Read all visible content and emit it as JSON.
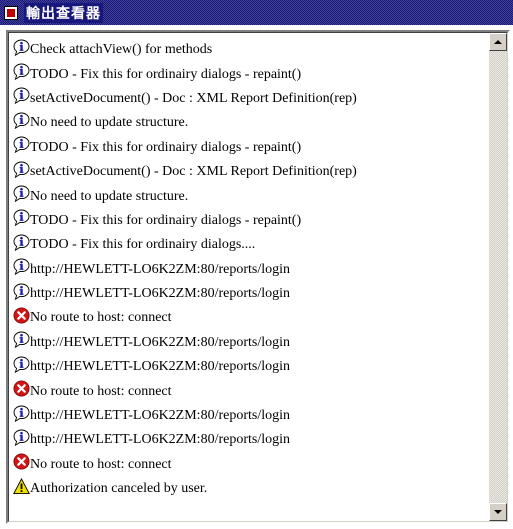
{
  "window": {
    "title": "輸出查看器"
  },
  "colors": {
    "titlebar": "#18177c",
    "info_icon": "#1a1aa6",
    "error_icon": "#d21414",
    "warning_icon": "#f0e000"
  },
  "log": {
    "entries": [
      {
        "icon": "info-icon",
        "text": "Check attachView() for methods"
      },
      {
        "icon": "info-icon",
        "text": "TODO - Fix this for ordinairy dialogs - repaint()"
      },
      {
        "icon": "info-icon",
        "text": "setActiveDocument() - Doc : XML Report Definition(rep)"
      },
      {
        "icon": "info-icon",
        "text": "No need to update structure."
      },
      {
        "icon": "info-icon",
        "text": "TODO - Fix this for ordinairy dialogs - repaint()"
      },
      {
        "icon": "info-icon",
        "text": "setActiveDocument() - Doc : XML Report Definition(rep)"
      },
      {
        "icon": "info-icon",
        "text": "No need to update structure."
      },
      {
        "icon": "info-icon",
        "text": "TODO - Fix this for ordinairy dialogs - repaint()"
      },
      {
        "icon": "info-icon",
        "text": "TODO - Fix this for ordinairy dialogs...."
      },
      {
        "icon": "info-icon",
        "text": "http://HEWLETT-LO6K2ZM:80/reports/login"
      },
      {
        "icon": "info-icon",
        "text": "http://HEWLETT-LO6K2ZM:80/reports/login"
      },
      {
        "icon": "error-icon",
        "text": "No route to host: connect"
      },
      {
        "icon": "info-icon",
        "text": "http://HEWLETT-LO6K2ZM:80/reports/login"
      },
      {
        "icon": "info-icon",
        "text": "http://HEWLETT-LO6K2ZM:80/reports/login"
      },
      {
        "icon": "error-icon",
        "text": "No route to host: connect"
      },
      {
        "icon": "info-icon",
        "text": "http://HEWLETT-LO6K2ZM:80/reports/login"
      },
      {
        "icon": "info-icon",
        "text": "http://HEWLETT-LO6K2ZM:80/reports/login"
      },
      {
        "icon": "error-icon",
        "text": "No route to host: connect"
      },
      {
        "icon": "warning-icon",
        "text": "Authorization canceled by user."
      }
    ]
  },
  "scrollbar": {
    "up_icon": "arrow-up-icon",
    "down_icon": "arrow-down-icon"
  }
}
